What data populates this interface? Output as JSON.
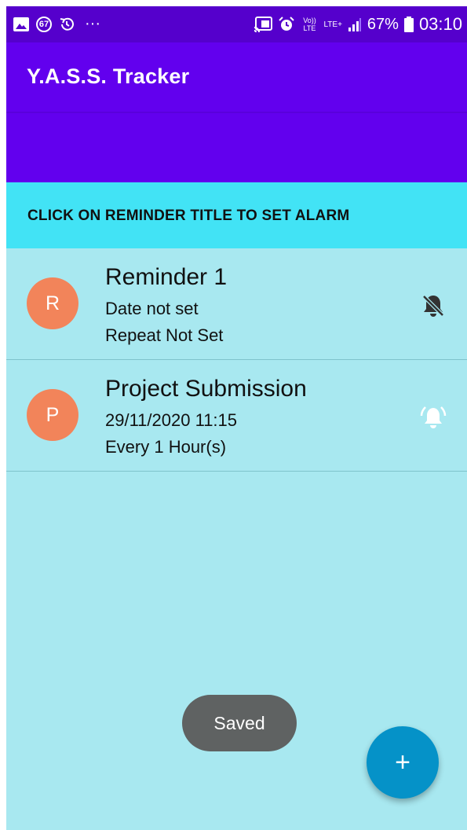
{
  "status_bar": {
    "notification_count": "67",
    "more_dots": "···",
    "network_voice": "Vo)) LTE",
    "network_data": "LTE+",
    "battery_percent": "67%",
    "time": "03:10",
    "icons": [
      "gallery-icon",
      "notification-count-icon",
      "history-icon",
      "cast-icon",
      "alarm-icon",
      "volte-icon",
      "lte-icon",
      "signal-icon",
      "battery-icon"
    ]
  },
  "app_bar": {
    "title": "Y.A.S.S. Tracker",
    "color": "#6200ee"
  },
  "banner": {
    "text": "CLICK ON REMINDER TITLE TO SET ALARM",
    "color": "#42e3f5"
  },
  "reminders": [
    {
      "avatar_letter": "R",
      "title": "Reminder 1",
      "date": "Date not set",
      "repeat": "Repeat Not Set",
      "alarm_icon": "bell-off-icon",
      "alarm_on": false
    },
    {
      "avatar_letter": "P",
      "title": "Project Submission",
      "date": "29/11/2020 11:15",
      "repeat": "Every 1 Hour(s)",
      "alarm_icon": "bell-ringing-icon",
      "alarm_on": true
    }
  ],
  "toast": {
    "text": "Saved"
  },
  "fab": {
    "label": "+",
    "icon": "plus-icon",
    "color": "#0592c8"
  },
  "colors": {
    "list_background": "#a8e8f0",
    "avatar": "#f2845a"
  }
}
